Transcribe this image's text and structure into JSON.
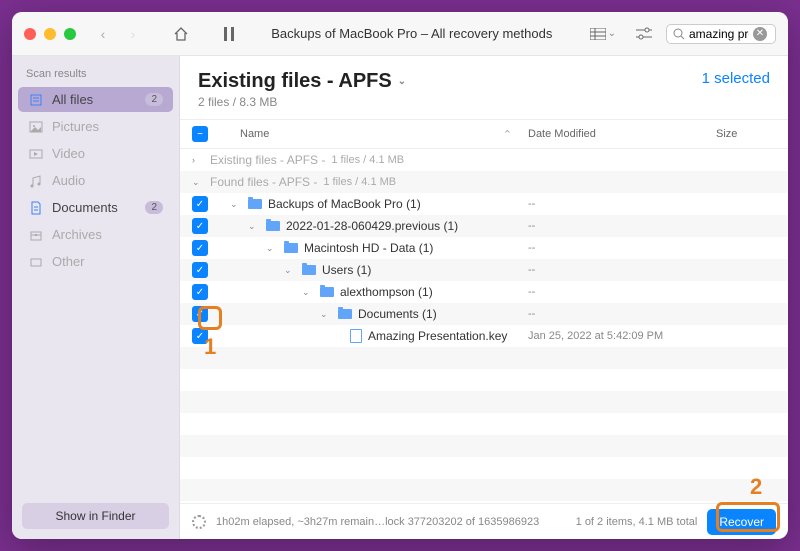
{
  "window": {
    "title": "Backups of MacBook Pro – All recovery methods",
    "search_value": "amazing pre"
  },
  "sidebar": {
    "header": "Scan results",
    "items": [
      {
        "label": "All files",
        "count": "2"
      },
      {
        "label": "Pictures"
      },
      {
        "label": "Video"
      },
      {
        "label": "Audio"
      },
      {
        "label": "Documents",
        "count": "2"
      },
      {
        "label": "Archives"
      },
      {
        "label": "Other"
      }
    ],
    "show_finder": "Show in Finder"
  },
  "header": {
    "title": "Existing files - APFS",
    "subtitle": "2 files / 8.3 MB",
    "selected": "1 selected"
  },
  "columns": {
    "name": "Name",
    "date": "Date Modified",
    "size": "Size"
  },
  "groups": {
    "existing": "Existing files - APFS -",
    "existing_meta": "1 files / 4.1 MB",
    "found": "Found files - APFS -",
    "found_meta": "1 files / 4.1 MB"
  },
  "rows": [
    {
      "indent": 0,
      "label": "Backups of MacBook Pro (1)",
      "date": "--"
    },
    {
      "indent": 1,
      "label": "2022-01-28-060429.previous (1)",
      "date": "--"
    },
    {
      "indent": 2,
      "label": "Macintosh HD - Data (1)",
      "date": "--"
    },
    {
      "indent": 3,
      "label": "Users (1)",
      "date": "--"
    },
    {
      "indent": 4,
      "label": "alexthompson (1)",
      "date": "--"
    },
    {
      "indent": 5,
      "label": "Documents (1)",
      "date": "--"
    },
    {
      "indent": 6,
      "label": "Amazing Presentation.key",
      "date": "Jan 25, 2022 at 5:42:09 PM",
      "file": true
    }
  ],
  "status": {
    "progress": "1h02m elapsed, ~3h27m remain…lock 377203202 of 1635986923",
    "summary": "1 of 2 items, 4.1 MB total",
    "recover": "Recover"
  },
  "annotations": {
    "a1": "1",
    "a2": "2"
  }
}
